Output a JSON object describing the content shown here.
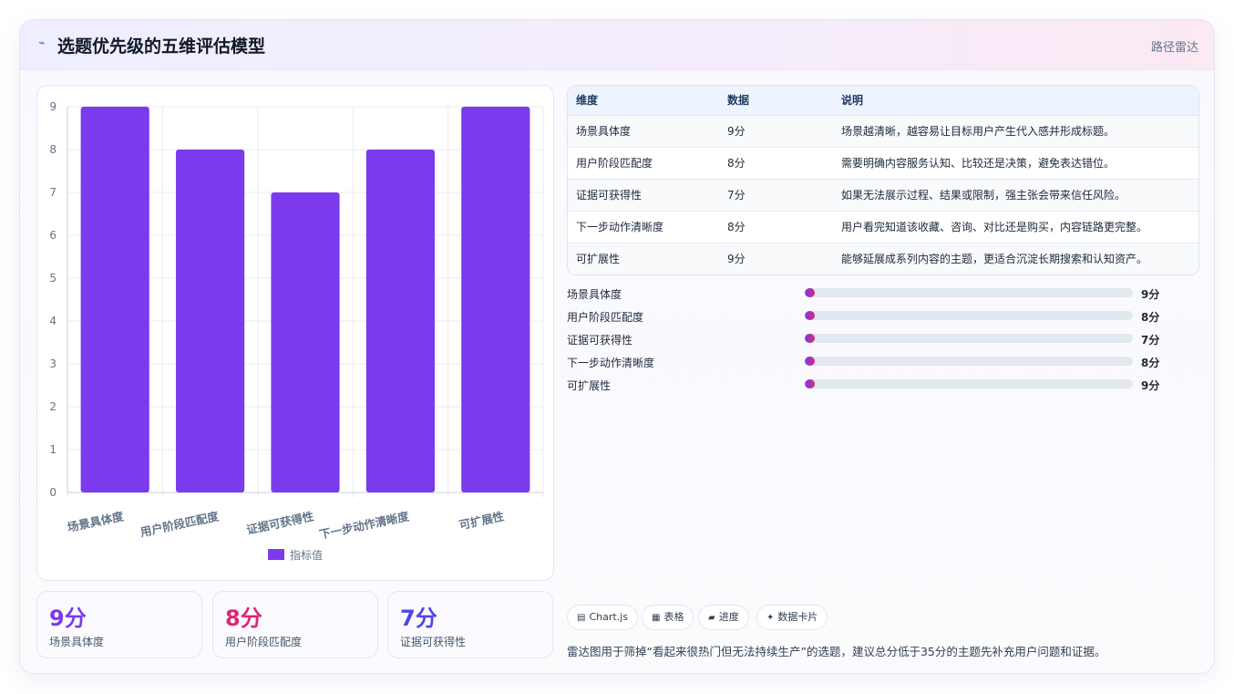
{
  "header": {
    "icon": "trend-icon",
    "title": "选题优先级的五维评估模型",
    "link": "路径雷达"
  },
  "chart_data": {
    "type": "bar",
    "categories": [
      "场景具体度",
      "用户阶段匹配度",
      "证据可获得性",
      "下一步动作清晰度",
      "可扩展性"
    ],
    "series": [
      {
        "name": "指标值",
        "values": [
          9,
          8,
          7,
          8,
          9
        ]
      }
    ],
    "ylim": [
      0,
      9
    ],
    "yticks": [
      0,
      1,
      2,
      3,
      4,
      5,
      6,
      7,
      8,
      9
    ],
    "grid": true,
    "legend": "bottom",
    "color": "#7c3aed"
  },
  "stats": [
    {
      "value": "9分",
      "label": "场景具体度",
      "color": "#7c3aed"
    },
    {
      "value": "8分",
      "label": "用户阶段匹配度",
      "color": "#db2777"
    },
    {
      "value": "7分",
      "label": "证据可获得性",
      "color": "#4f46e5"
    }
  ],
  "table": {
    "headers": [
      "维度",
      "数据",
      "说明"
    ],
    "rows": [
      [
        "场景具体度",
        "9分",
        "场景越清晰，越容易让目标用户产生代入感并形成标题。"
      ],
      [
        "用户阶段匹配度",
        "8分",
        "需要明确内容服务认知、比较还是决策，避免表达错位。"
      ],
      [
        "证据可获得性",
        "7分",
        "如果无法展示过程、结果或限制，强主张会带来信任风险。"
      ],
      [
        "下一步动作清晰度",
        "8分",
        "用户看完知道该收藏、咨询、对比还是购买，内容链路更完整。"
      ],
      [
        "可扩展性",
        "9分",
        "能够延展成系列内容的主题，更适合沉淀长期搜索和认知资产。"
      ]
    ]
  },
  "progress": [
    {
      "label": "场景具体度",
      "value": "9分",
      "level": 0.03
    },
    {
      "label": "用户阶段匹配度",
      "value": "8分",
      "level": 0.03
    },
    {
      "label": "证据可获得性",
      "value": "7分",
      "level": 0.03
    },
    {
      "label": "下一步动作清晰度",
      "value": "8分",
      "level": 0.03
    },
    {
      "label": "可扩展性",
      "value": "9分",
      "level": 0.03
    }
  ],
  "chips": [
    {
      "icon": "chart-icon",
      "glyph": "▤",
      "label": "Chart.js"
    },
    {
      "icon": "table-icon",
      "glyph": "▦",
      "label": "表格"
    },
    {
      "icon": "progress-icon",
      "glyph": "▰",
      "label": "进度"
    },
    {
      "icon": "card-icon",
      "glyph": "✦",
      "label": "数据卡片"
    }
  ],
  "footnote": "雷达图用于筛掉“看起来很热门但无法持续生产”的选题，建议总分低于35分的主题先补充用户问题和证据。"
}
